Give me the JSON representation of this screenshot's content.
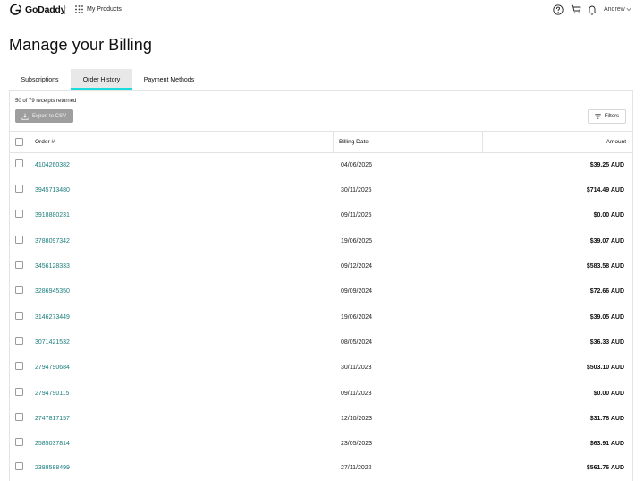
{
  "header": {
    "logo_text": "GoDaddy",
    "products_label": "My Products",
    "user_name": "Andrew"
  },
  "page": {
    "title": "Manage your Billing"
  },
  "tabs": [
    {
      "label": "Subscriptions",
      "active": false
    },
    {
      "label": "Order History",
      "active": true
    },
    {
      "label": "Payment Methods",
      "active": false
    }
  ],
  "toolbar": {
    "receipts_text": "50 of 79 receipts returned",
    "export_label": "Export to CSV",
    "filters_label": "Filters"
  },
  "table": {
    "columns": [
      "Order #",
      "Billing Date",
      "Amount"
    ],
    "rows": [
      {
        "order": "4104260382",
        "date": "04/06/2026",
        "amount": "$39.25 AUD"
      },
      {
        "order": "3945713480",
        "date": "30/11/2025",
        "amount": "$714.49 AUD"
      },
      {
        "order": "3918880231",
        "date": "09/11/2025",
        "amount": "$0.00 AUD"
      },
      {
        "order": "3788097342",
        "date": "19/06/2025",
        "amount": "$39.07 AUD"
      },
      {
        "order": "3456128333",
        "date": "09/12/2024",
        "amount": "$583.58 AUD"
      },
      {
        "order": "3286945350",
        "date": "09/09/2024",
        "amount": "$72.66 AUD"
      },
      {
        "order": "3146273449",
        "date": "19/06/2024",
        "amount": "$39.05 AUD"
      },
      {
        "order": "3071421532",
        "date": "08/05/2024",
        "amount": "$36.33 AUD"
      },
      {
        "order": "2794790684",
        "date": "30/11/2023",
        "amount": "$503.10 AUD"
      },
      {
        "order": "2794790115",
        "date": "09/11/2023",
        "amount": "$0.00 AUD"
      },
      {
        "order": "2747817157",
        "date": "12/10/2023",
        "amount": "$31.78 AUD"
      },
      {
        "order": "2585037814",
        "date": "23/05/2023",
        "amount": "$63.91 AUD"
      },
      {
        "order": "2388588499",
        "date": "27/11/2022",
        "amount": "$561.76 AUD"
      }
    ]
  },
  "colors": {
    "accent_tab_underline": "#1bdbdb",
    "link": "#1a7c7c",
    "export_button": "#9e9e9e"
  }
}
